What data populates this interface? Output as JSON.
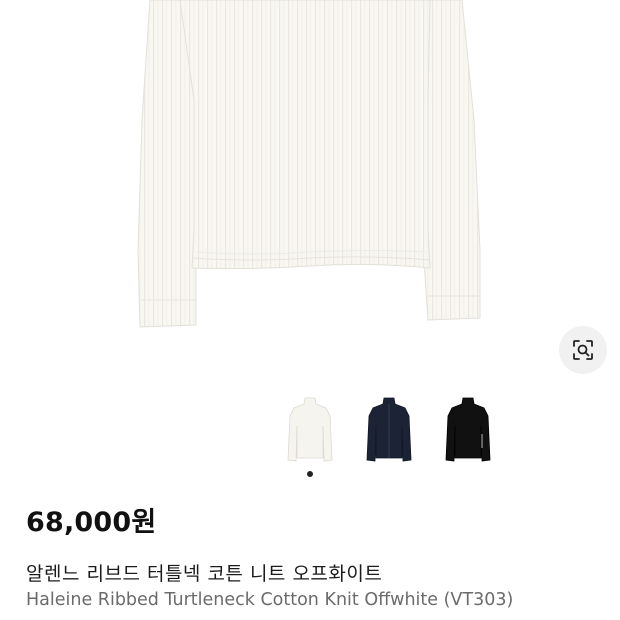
{
  "product": {
    "price": "68,000원",
    "name_ko": "알렌느 리브드 터틀넥 코튼 니트 오프화이트",
    "name_en": "Haleine Ribbed Turtleneck Cotton Knit Offwhite (VT303)"
  },
  "gallery": {
    "main_image": "offwhite-ribbed-turtleneck-sweater",
    "lens_icon": "image-search-icon",
    "colors": {
      "offwhite": "#f7f6f1",
      "navy": "#1b2335",
      "black": "#111111"
    },
    "active_index": 0
  }
}
